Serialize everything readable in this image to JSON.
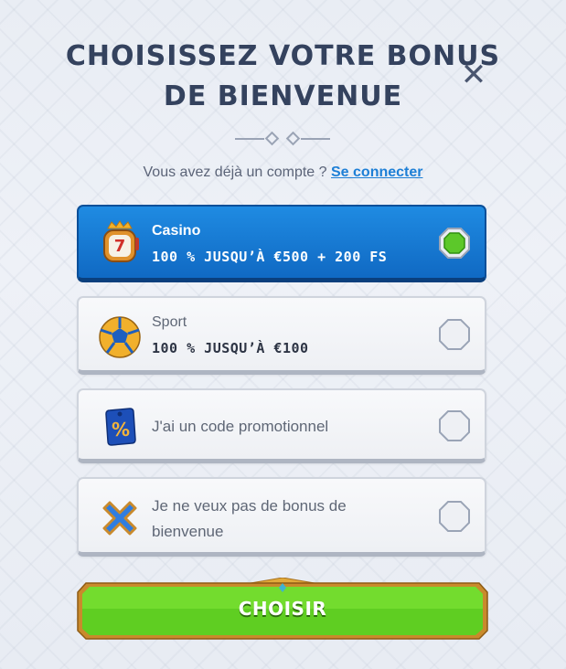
{
  "modal": {
    "title_line1": "CHOISISSEZ VOTRE BONUS",
    "title_line2": "DE BIENVENUE",
    "close_symbol": "✕",
    "login_prompt": "Vous avez déjà un compte ?",
    "login_link": "Se connecter"
  },
  "options": [
    {
      "title": "Casino",
      "offer": "100 % JUSQU’À €500 + 200 FS",
      "icon": "slot-machine-icon",
      "selected": true
    },
    {
      "title": "Sport",
      "offer": "100 % JUSQU’À €100",
      "icon": "soccer-ball-icon",
      "selected": false
    },
    {
      "title": "J'ai un code promotionnel",
      "icon": "percent-tag-icon",
      "selected": false
    },
    {
      "title_line1": "Je ne veux pas de bonus de",
      "title_line2": "bienvenue",
      "icon": "no-bonus-x-icon",
      "selected": false
    }
  ],
  "cta": {
    "label": "CHOISIR"
  },
  "colors": {
    "selected_card": "#1f8be2",
    "radio_selected": "#5cc82a",
    "cta_green": "#5fce22",
    "cta_border": "#c98a2c",
    "title": "#34425e",
    "link": "#1d7fd6"
  }
}
